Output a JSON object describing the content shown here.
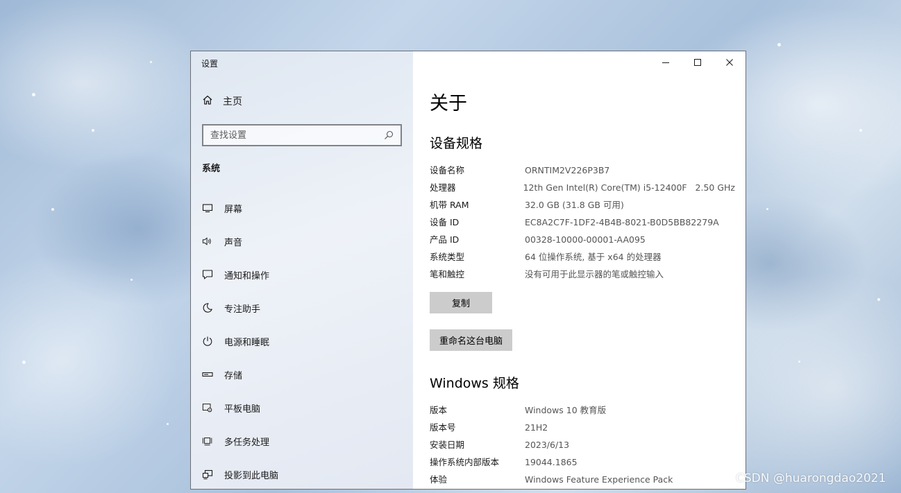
{
  "window": {
    "title": "设置",
    "caption": {
      "minimize": "minimize-icon",
      "maximize": "maximize-icon",
      "close": "close-icon"
    }
  },
  "sidebar": {
    "home_label": "主页",
    "search_placeholder": "查找设置",
    "section_title": "系统",
    "items": [
      {
        "label": "屏幕",
        "icon": "display-icon"
      },
      {
        "label": "声音",
        "icon": "speaker-icon"
      },
      {
        "label": "通知和操作",
        "icon": "notification-icon"
      },
      {
        "label": "专注助手",
        "icon": "moon-icon"
      },
      {
        "label": "电源和睡眠",
        "icon": "power-icon"
      },
      {
        "label": "存储",
        "icon": "storage-icon"
      },
      {
        "label": "平板电脑",
        "icon": "tablet-icon"
      },
      {
        "label": "多任务处理",
        "icon": "multitask-icon"
      },
      {
        "label": "投影到此电脑",
        "icon": "project-icon"
      }
    ]
  },
  "main": {
    "page_title": "关于",
    "device_specs": {
      "heading": "设备规格",
      "rows": [
        {
          "key": "设备名称",
          "value": "ORNTIM2V226P3B7"
        },
        {
          "key": "处理器",
          "value": "12th Gen Intel(R) Core(TM) i5-12400F   2.50 GHz"
        },
        {
          "key": "机带 RAM",
          "value": "32.0 GB (31.8 GB 可用)"
        },
        {
          "key": "设备 ID",
          "value": "EC8A2C7F-1DF2-4B4B-8021-B0D5BB82279A"
        },
        {
          "key": "产品 ID",
          "value": "00328-10000-00001-AA095"
        },
        {
          "key": "系统类型",
          "value": "64 位操作系统, 基于 x64 的处理器"
        },
        {
          "key": "笔和触控",
          "value": "没有可用于此显示器的笔或触控输入"
        }
      ],
      "copy_button": "复制",
      "rename_button": "重命名这台电脑"
    },
    "windows_specs": {
      "heading": "Windows 规格",
      "rows": [
        {
          "key": "版本",
          "value": "Windows 10 教育版"
        },
        {
          "key": "版本号",
          "value": "21H2"
        },
        {
          "key": "安装日期",
          "value": "2023/6/13"
        },
        {
          "key": "操作系统内部版本",
          "value": "19044.1865"
        },
        {
          "key": "体验",
          "value": "Windows Feature Experience Pack"
        }
      ]
    }
  },
  "watermark": "CSDN @huarongdao2021",
  "colors": {
    "button_bg": "#cccccc",
    "value_text": "#555555",
    "sidebar_bg": "#e6ecf4"
  }
}
